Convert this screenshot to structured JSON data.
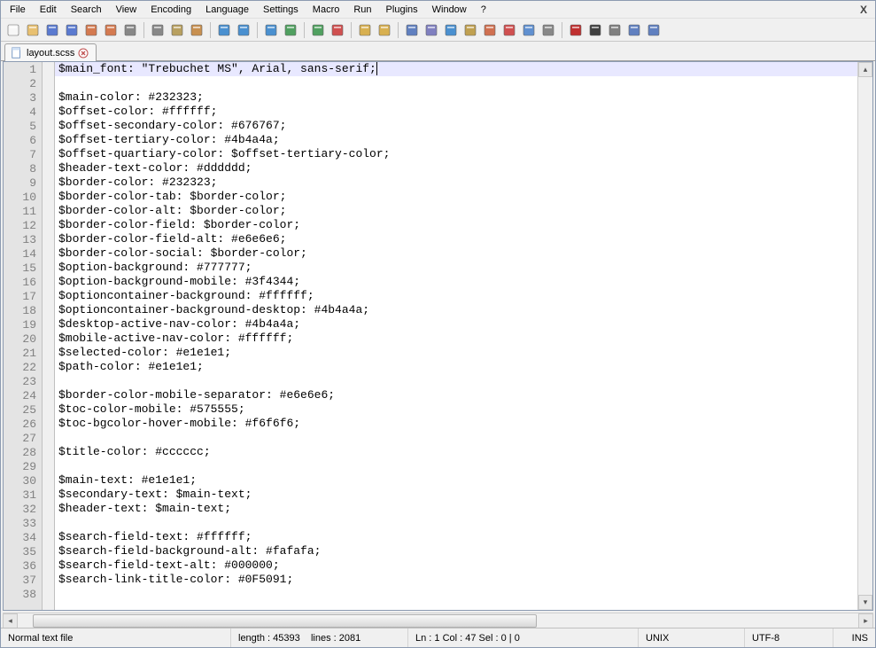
{
  "menus": [
    "File",
    "Edit",
    "Search",
    "View",
    "Encoding",
    "Language",
    "Settings",
    "Macro",
    "Run",
    "Plugins",
    "Window",
    "?"
  ],
  "close_label": "X",
  "tab": {
    "filename": "layout.scss"
  },
  "lines": [
    "$main_font: \"Trebuchet MS\", Arial, sans-serif;",
    "",
    "$main-color: #232323;",
    "$offset-color: #ffffff;",
    "$offset-secondary-color: #676767;",
    "$offset-tertiary-color: #4b4a4a;",
    "$offset-quartiary-color: $offset-tertiary-color;",
    "$header-text-color: #dddddd;",
    "$border-color: #232323;",
    "$border-color-tab: $border-color;",
    "$border-color-alt: $border-color;",
    "$border-color-field: $border-color;",
    "$border-color-field-alt: #e6e6e6;",
    "$border-color-social: $border-color;",
    "$option-background: #777777;",
    "$option-background-mobile: #3f4344;",
    "$optioncontainer-background: #ffffff;",
    "$optioncontainer-background-desktop: #4b4a4a;",
    "$desktop-active-nav-color: #4b4a4a;",
    "$mobile-active-nav-color: #ffffff;",
    "$selected-color: #e1e1e1;",
    "$path-color: #e1e1e1;",
    "",
    "$border-color-mobile-separator: #e6e6e6;",
    "$toc-color-mobile: #575555;",
    "$toc-bgcolor-hover-mobile: #f6f6f6;",
    "",
    "$title-color: #cccccc;",
    "",
    "$main-text: #e1e1e1;",
    "$secondary-text: $main-text;",
    "$header-text: $main-text;",
    "",
    "$search-field-text: #ffffff;",
    "$search-field-background-alt: #fafafa;",
    "$search-field-text-alt: #000000;",
    "$search-link-title-color: #0F5091;",
    ""
  ],
  "status": {
    "filetype": "Normal text file",
    "length_label": "length : 45393",
    "lines_label": "lines : 2081",
    "pos_label": "Ln : 1    Col : 47    Sel : 0 | 0",
    "eol": "UNIX",
    "encoding": "UTF-8",
    "mode": "INS"
  },
  "toolbar_icons": [
    {
      "n": "new-file-icon"
    },
    {
      "n": "open-file-icon"
    },
    {
      "n": "save-icon"
    },
    {
      "n": "save-all-icon"
    },
    {
      "n": "close-file-icon"
    },
    {
      "n": "close-all-icon"
    },
    {
      "n": "print-icon"
    },
    {
      "sep": true
    },
    {
      "n": "cut-icon"
    },
    {
      "n": "copy-icon"
    },
    {
      "n": "paste-icon"
    },
    {
      "sep": true
    },
    {
      "n": "undo-icon"
    },
    {
      "n": "redo-icon"
    },
    {
      "sep": true
    },
    {
      "n": "find-icon"
    },
    {
      "n": "replace-icon"
    },
    {
      "sep": true
    },
    {
      "n": "zoom-in-icon"
    },
    {
      "n": "zoom-out-icon"
    },
    {
      "sep": true
    },
    {
      "n": "sync-v-icon"
    },
    {
      "n": "sync-h-icon"
    },
    {
      "sep": true
    },
    {
      "n": "wordwrap-icon"
    },
    {
      "n": "all-chars-icon"
    },
    {
      "n": "indent-guide-icon"
    },
    {
      "n": "lang-udl-icon"
    },
    {
      "n": "doc-map-icon"
    },
    {
      "n": "func-list-icon"
    },
    {
      "n": "folder-workspace-icon"
    },
    {
      "n": "monitoring-icon"
    },
    {
      "sep": true
    },
    {
      "n": "record-macro-icon"
    },
    {
      "n": "stop-macro-icon"
    },
    {
      "n": "play-macro-icon"
    },
    {
      "n": "play-multi-icon"
    },
    {
      "n": "save-macro-icon"
    }
  ]
}
